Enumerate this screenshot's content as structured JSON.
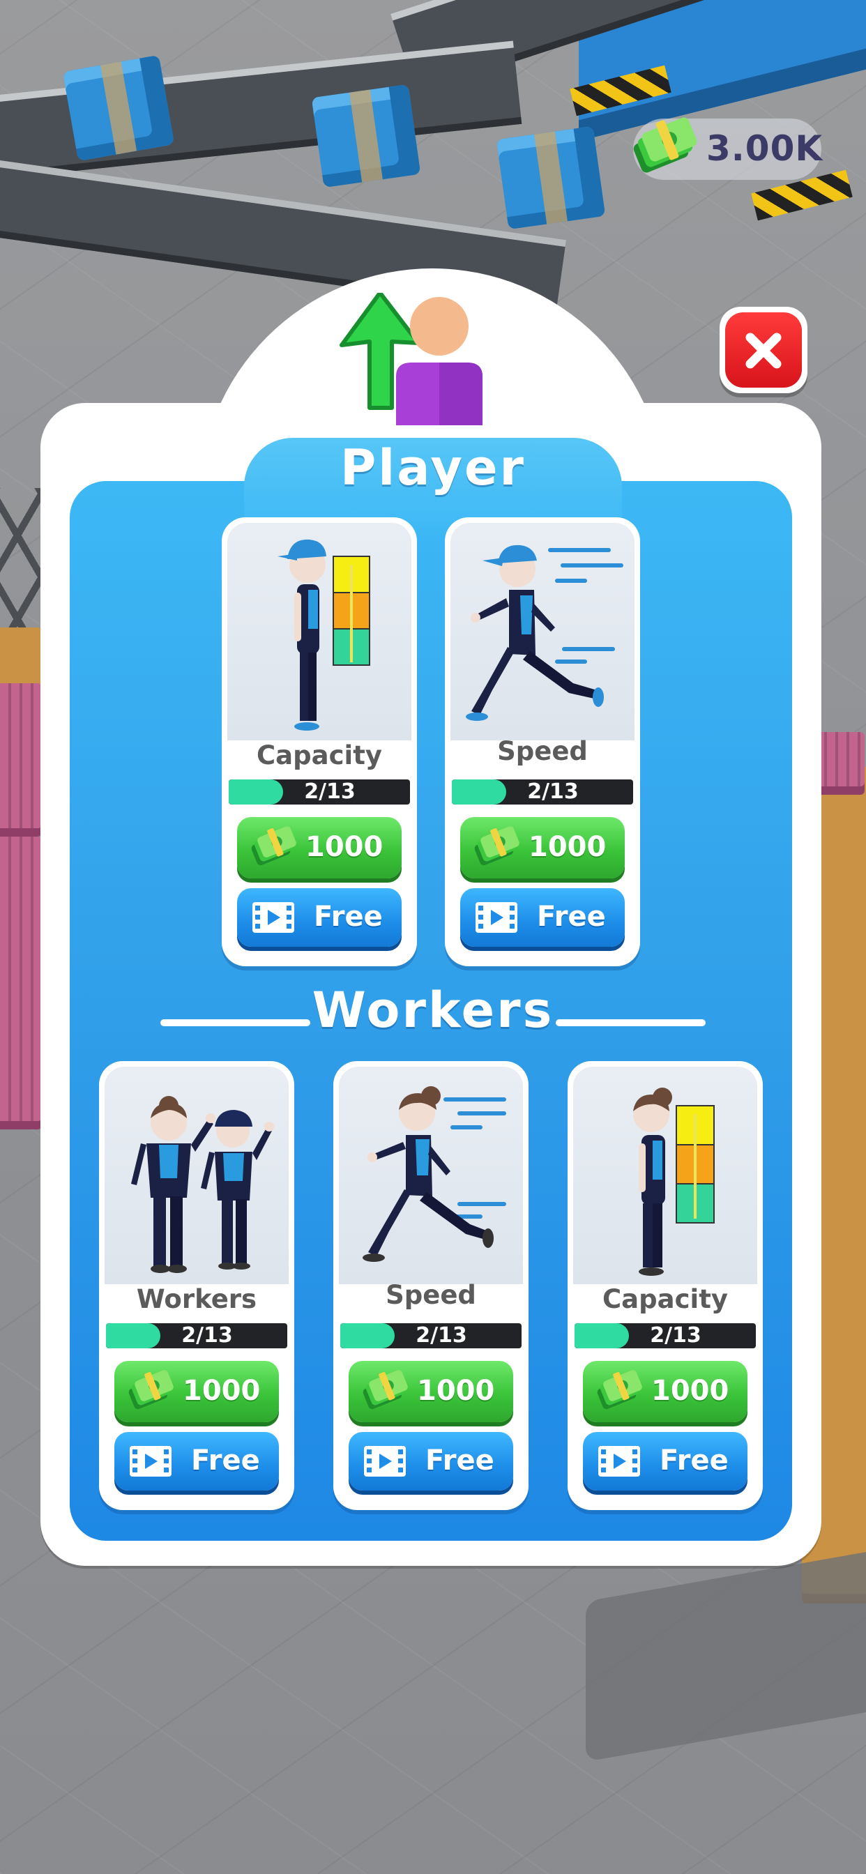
{
  "hud": {
    "money": "3.00K"
  },
  "dialog": {
    "player_section_title": "Player",
    "workers_section_title": "Workers",
    "player_upgrades": [
      {
        "label": "Capacity",
        "level": "2/13",
        "progress": 0.154,
        "price": "1000",
        "free_label": "Free"
      },
      {
        "label": "Speed",
        "level": "2/13",
        "progress": 0.154,
        "price": "1000",
        "free_label": "Free"
      }
    ],
    "worker_upgrades": [
      {
        "label": "Workers",
        "level": "2/13",
        "progress": 0.154,
        "price": "1000",
        "free_label": "Free"
      },
      {
        "label": "Speed",
        "level": "2/13",
        "progress": 0.154,
        "price": "1000",
        "free_label": "Free"
      },
      {
        "label": "Capacity",
        "level": "2/13",
        "progress": 0.154,
        "price": "1000",
        "free_label": "Free"
      }
    ]
  },
  "icons": {
    "header": "player-upgrade-icon",
    "close": "close-icon",
    "currency": "cash-icon",
    "rewarded_ad": "video-icon"
  },
  "colors": {
    "panel_blue": "#2f9ce8",
    "buy_green": "#3bc43a",
    "free_blue": "#1d8de9",
    "progress_fill": "#2fdba0",
    "close_red": "#e3202a"
  }
}
